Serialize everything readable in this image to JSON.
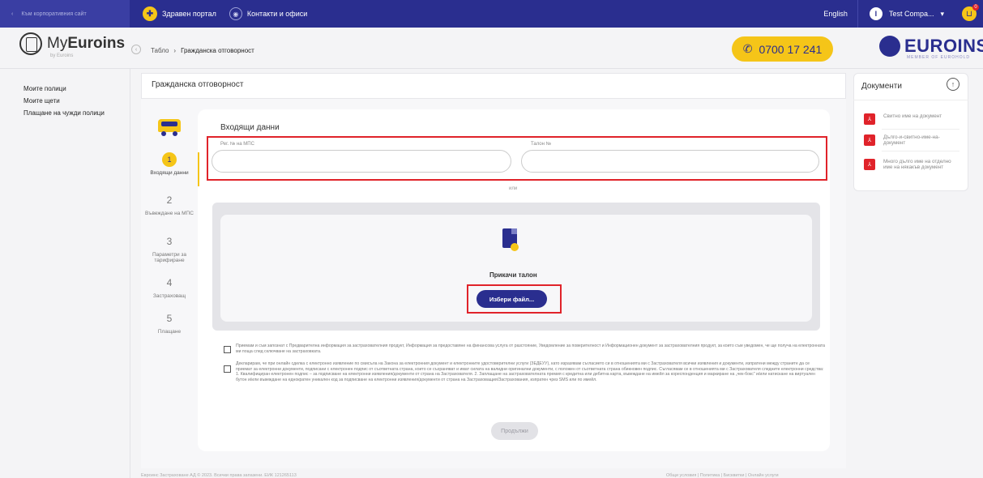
{
  "topbar": {
    "back_label": "Към корпоративния сайт",
    "health_portal": "Здравен портал",
    "contacts": "Контакти и офиси",
    "language": "English",
    "user_initial": "I",
    "user_name": "Test Compa...",
    "cart_count": "0"
  },
  "header": {
    "logo_prefix": "My",
    "logo_bold": "Euroins",
    "logo_sub": "by Euroins",
    "phone": "0700 17 241",
    "brand": "EUROINS",
    "brand_sub": "MEMBER OF EUROHOLD"
  },
  "breadcrumb": {
    "home": "Табло",
    "sep": "›",
    "current": "Гражданска отговорност"
  },
  "leftnav": [
    "Моите полици",
    "Моите щети",
    "Плащане на чужди полици"
  ],
  "page": {
    "title": "Гражданска отговорност"
  },
  "steps": [
    {
      "num": "1",
      "label": "Входящи данни"
    },
    {
      "num": "2",
      "label": "Въвеждане на МПС"
    },
    {
      "num": "3",
      "label": "Параметри за тарифиране"
    },
    {
      "num": "4",
      "label": "Застраховащ"
    },
    {
      "num": "5",
      "label": "Плащане"
    }
  ],
  "form": {
    "section_title": "Входящи данни",
    "field1_label": "Рег. № на МПС",
    "field2_label": "Талон №",
    "or_label": "или",
    "upload_label": "Прикачи талон",
    "choose_button": "Избери файл...",
    "consent1": "Приемам и съм запознат с Предварителна информация за застрахователния продукт, Информация за предоставяне на финансова услуга от разстояние, Уведомление за поверителност и Информационен документ за застрахователния продукт, за които съм уведомен, че ще получа на електронната ми поща след сключване на застраховката.",
    "consent2": "Декларирам, че при онлайн сделка с електронно изявление по смисъла на Закона за електронния документ и електронните удостоверителни услуги (ЗЕДЕУУ), като изразявам съгласието си в отношенията ми с Застрахователя всички изявления и документи, изпратени между страните да се приемат за електронни документи, подписани с електронен подпис от съответната страна, които се съхраняват и имат силата на валидни оригинални документи, с положен от съответната страна обикновен подпис. Съгласявам се в отношенията ми с Застрахователя следните електронни средства: 1. Квалифициран електронен подпис – за подписване на електронни изявления/документи от страна на Застрахователя. 2. Заплащане на застрахователната премия с кредитна или дебитна карта, въвеждане на имейл за кореспонденция и маркиране на „чек-бокс” и/или натискане на виртуален бутон и/или въвеждане на еднократен уникален код за подписване на електронни изявления/документи от страна на Застраховащия/Застрахования, изпратен чрез SMS или по имейл.",
    "continue_button": "Продължи"
  },
  "footer": {
    "left": "Евроинс Застраховане АД © 2023. Всички права запазени. ЕИК 121265113",
    "right": "Общи условия | Политика | Бисквитки | Онлайн услуги"
  },
  "documents": {
    "title": "Документи",
    "items": [
      "Свитно име на документ",
      "Дълго-и-свитно-име-на-документ",
      "Много дълго име на отделно име на някакъв документ"
    ]
  },
  "colors": {
    "primary": "#2a2e8f",
    "accent": "#f5c518",
    "highlight": "#e0232a"
  }
}
